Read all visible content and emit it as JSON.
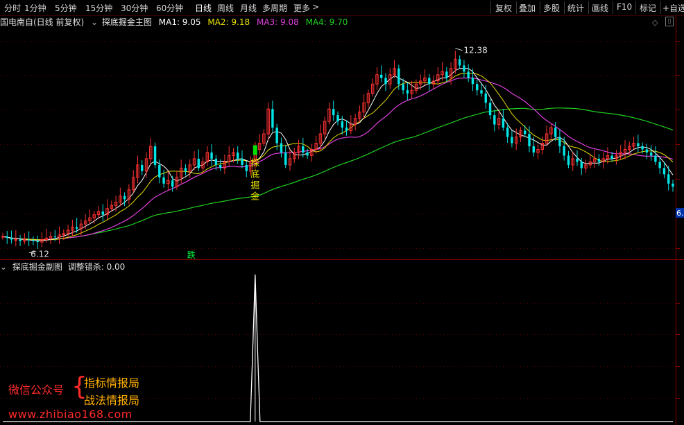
{
  "topbar": {
    "periods": [
      "分时",
      "1分钟",
      "5分钟",
      "15分钟",
      "30分钟",
      "60分钟",
      "日线",
      "周线",
      "月线",
      "多周期",
      "更多"
    ],
    "active_period": "日线",
    "right_buttons": [
      "复权",
      "叠加",
      "多股",
      "统计",
      "画线",
      "F10",
      "标记",
      "+自选"
    ]
  },
  "main_header": {
    "stock": "国电南自(日线 前复权)",
    "indicator": "探底掘金主图",
    "ma1": "MA1: 9.05",
    "ma2": "MA2: 9.18",
    "ma3": "MA3: 9.08",
    "ma4": "MA4: 9.70"
  },
  "sub_header": {
    "indicator": "探底掘金副图",
    "value": "调整错杀: 0.00"
  },
  "watermark": {
    "left": "微信公众号",
    "brace": "{",
    "right1": "指标情报局",
    "right2": "战法情报局",
    "url": "www.zhibiao168.com"
  },
  "colors": {
    "up": "#ff3232",
    "down": "#00e6e6",
    "ma1": "#ffffff",
    "ma2": "#e8e000",
    "ma3": "#e040e0",
    "ma4": "#20d020",
    "signal": "#e8e000",
    "event": "#00ff40"
  },
  "chart_data": {
    "type": "candlestick",
    "price_high_label": "12.38",
    "price_low_label": "6.12",
    "right_axis_label": "6.",
    "signal_text": "探底掘金",
    "event_text": "跌",
    "ylim": [
      5.7,
      12.9
    ],
    "ma_values": {
      "MA1": 9.05,
      "MA2": 9.18,
      "MA3": 9.08,
      "MA4": 9.7
    },
    "closes": [
      6.3,
      6.25,
      6.2,
      6.2,
      6.15,
      6.2,
      6.18,
      6.15,
      6.12,
      6.2,
      6.25,
      6.3,
      6.28,
      6.35,
      6.4,
      6.5,
      6.6,
      6.55,
      6.7,
      6.8,
      6.9,
      7.0,
      7.1,
      7.0,
      7.2,
      7.3,
      7.4,
      7.6,
      7.5,
      7.8,
      8.2,
      8.6,
      8.4,
      8.8,
      9.2,
      8.6,
      8.2,
      8.0,
      8.1,
      7.9,
      8.2,
      8.5,
      8.4,
      8.6,
      8.8,
      8.5,
      8.7,
      9.0,
      8.8,
      8.6,
      8.5,
      8.7,
      8.9,
      9.0,
      8.8,
      8.6,
      8.4,
      8.7,
      9.1,
      9.3,
      9.6,
      10.4,
      9.8,
      9.3,
      9.0,
      8.6,
      8.8,
      9.0,
      9.2,
      9.0,
      8.9,
      9.1,
      9.3,
      9.6,
      10.0,
      10.4,
      10.2,
      10.0,
      9.8,
      9.7,
      9.9,
      10.1,
      10.3,
      10.6,
      10.9,
      11.2,
      11.5,
      11.4,
      11.2,
      11.5,
      11.7,
      11.2,
      11.0,
      10.9,
      11.0,
      11.2,
      11.3,
      11.4,
      11.2,
      11.3,
      11.5,
      11.6,
      11.4,
      11.7,
      12.0,
      11.8,
      11.6,
      11.4,
      11.2,
      11.0,
      10.9,
      10.6,
      10.2,
      9.9,
      10.1,
      9.8,
      9.5,
      9.3,
      9.5,
      9.7,
      9.6,
      9.2,
      9.0,
      9.1,
      9.3,
      9.6,
      9.8,
      9.5,
      9.2,
      8.9,
      8.6,
      8.8,
      8.7,
      8.5,
      8.6,
      8.7,
      8.8,
      8.7,
      8.8,
      8.9,
      8.8,
      8.9,
      9.0,
      9.1,
      9.2,
      9.3,
      9.2,
      9.1,
      9.0,
      8.9,
      8.7,
      8.5,
      8.3,
      8.0,
      7.9
    ],
    "sub_panel": {
      "type": "spike",
      "spike_index": 58,
      "value": 0.0
    }
  }
}
